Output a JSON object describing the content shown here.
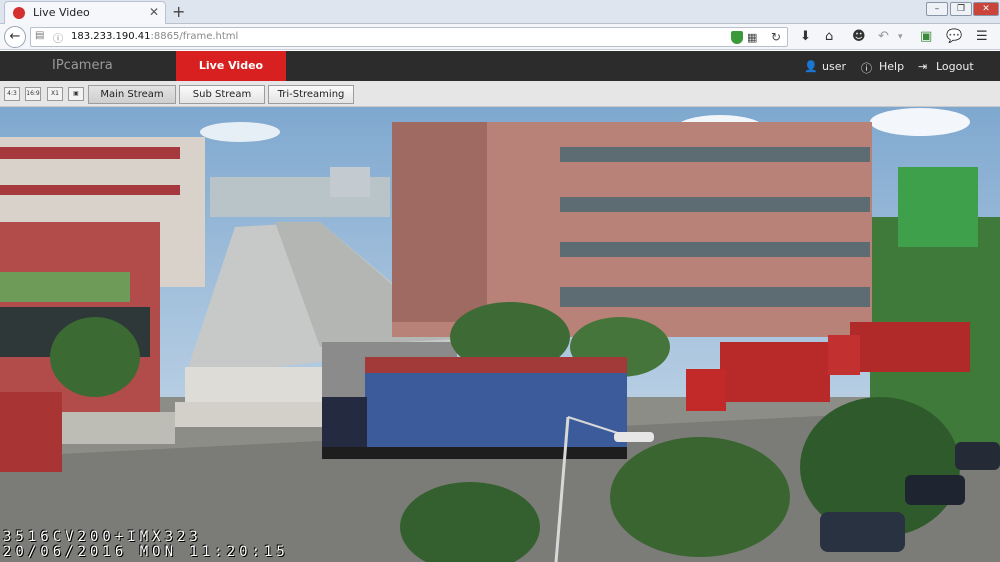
{
  "browser": {
    "tab_title": "Live Video",
    "url_host": "183.233.190.41",
    "url_rest": ":8865/frame.html"
  },
  "app": {
    "brand": "IPcamera",
    "active_tab": "Live Video",
    "user_label": "user",
    "help_label": "Help",
    "logout_label": "Logout"
  },
  "toolbar": {
    "ratio_4_3": "4:3",
    "ratio_16_9": "16:9",
    "ratio_x1": "X1",
    "main_stream": "Main Stream",
    "sub_stream": "Sub Stream",
    "tri_streaming": "Tri-Streaming"
  },
  "video": {
    "osd_line1": "3516CV200+IMX323",
    "osd_line2": "20/06/2016 MON 11:20:15"
  },
  "colors": {
    "accent": "#d7201f",
    "header_bg": "#2c2c2c"
  }
}
